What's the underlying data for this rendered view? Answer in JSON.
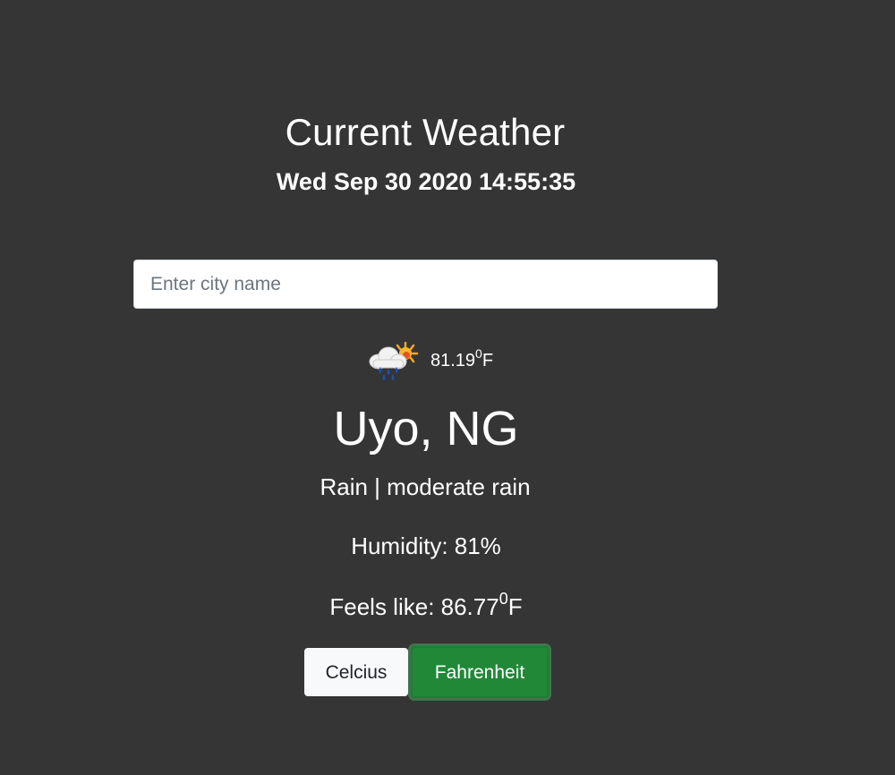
{
  "header": {
    "title": "Current Weather",
    "datetime": "Wed Sep 30 2020 14:55:35"
  },
  "search": {
    "placeholder": "Enter city name",
    "value": ""
  },
  "current": {
    "icon": "rain-cloud-sun-icon",
    "temperature": "81.19",
    "temperature_unit": "F",
    "degree_symbol": "0",
    "location": "Uyo, NG",
    "condition": "Rain | moderate rain",
    "humidity": "Humidity: 81%",
    "feels_like_label": "Feels like: ",
    "feels_like_value": "86.77",
    "feels_like_unit": "F"
  },
  "units": {
    "celsius_label": "Celcius",
    "fahrenheit_label": "Fahrenheit",
    "selected": "Fahrenheit"
  },
  "colors": {
    "background": "#353535",
    "selected_button": "#218838",
    "unselected_button": "#f8f9fa"
  }
}
